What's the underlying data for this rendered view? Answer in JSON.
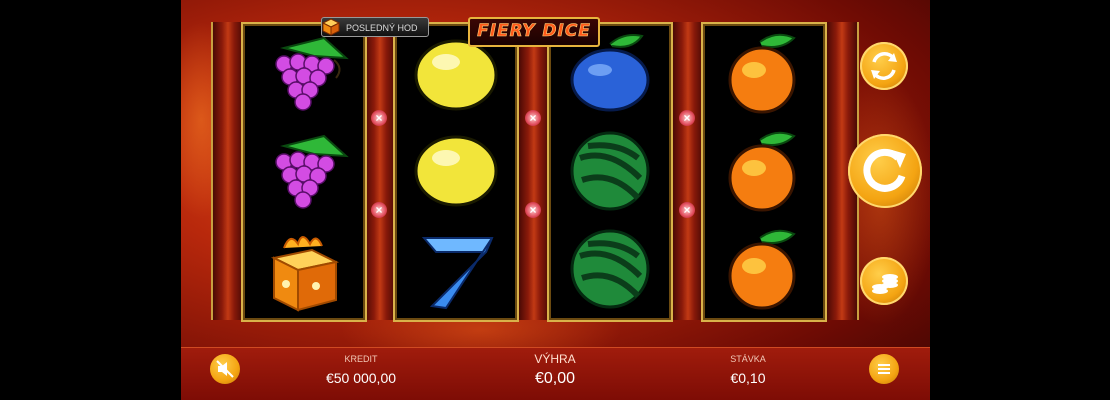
{
  "header": {
    "last_roll_label": "POSLEDNÝ HOD",
    "logo_text": "FIERY DICE"
  },
  "reels": [
    [
      "grapes",
      "grapes",
      "fire-dice"
    ],
    [
      "lemon",
      "lemon",
      "seven-crystal"
    ],
    [
      "plum",
      "watermelon",
      "watermelon"
    ],
    [
      "orange",
      "orange",
      "orange"
    ]
  ],
  "side_buttons": {
    "autoplay_icon": "autoplay-icon",
    "spin_icon": "spin-icon",
    "bet_icon": "coins-icon"
  },
  "bottom_bar": {
    "credit_label": "KREDIT",
    "credit_value": "€50 000,00",
    "win_label": "VÝHRA",
    "win_value": "€0,00",
    "bet_label": "STÁVKA",
    "bet_value": "€0,10",
    "sound_icon": "sound-off-icon",
    "menu_icon": "menu-icon"
  },
  "colors": {
    "accent_gold": "#f4a412",
    "bar_red": "#8d1408"
  }
}
